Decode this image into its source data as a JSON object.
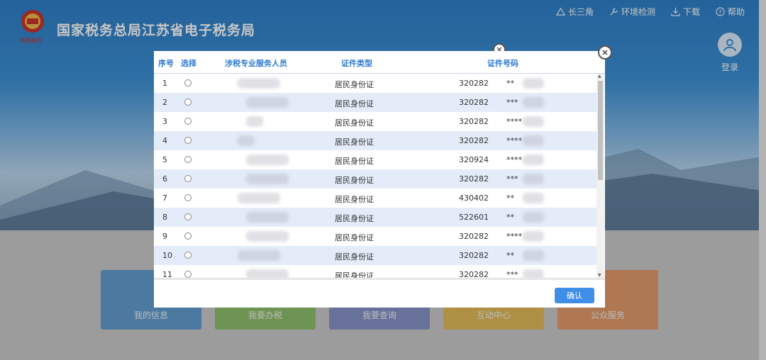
{
  "header": {
    "site_title": "国家税务总局江苏省电子税务局",
    "emblem_text": "中国税务",
    "nav": [
      {
        "icon": "triangle-icon",
        "label": "长三角"
      },
      {
        "icon": "wrench-icon",
        "label": "环境检测"
      },
      {
        "icon": "download-icon",
        "label": "下载"
      },
      {
        "icon": "help-icon",
        "label": "帮助"
      }
    ],
    "login_label": "登录"
  },
  "tiles": [
    {
      "label": "我的信息",
      "color": "#3e8ed1"
    },
    {
      "label": "我要办税",
      "color": "#7bba4a"
    },
    {
      "label": "我要查询",
      "color": "#6f7fc6"
    },
    {
      "label": "互动中心",
      "color": "#e7b534"
    },
    {
      "label": "公众服务",
      "color": "#e88b4d"
    }
  ],
  "modal": {
    "columns": [
      "序号",
      "选择",
      "涉税专业服务人员",
      "证件类型",
      "证件号码"
    ],
    "rows": [
      {
        "no": "1",
        "id_type": "居民身份证",
        "id_prefix": "320282",
        "id_mask": "**"
      },
      {
        "no": "2",
        "id_type": "居民身份证",
        "id_prefix": "320282",
        "id_mask": "***"
      },
      {
        "no": "3",
        "id_type": "居民身份证",
        "id_prefix": "320282",
        "id_mask": "****"
      },
      {
        "no": "4",
        "id_type": "居民身份证",
        "id_prefix": "320282",
        "id_mask": "****"
      },
      {
        "no": "5",
        "id_type": "居民身份证",
        "id_prefix": "320924",
        "id_mask": "****"
      },
      {
        "no": "6",
        "id_type": "居民身份证",
        "id_prefix": "320282",
        "id_mask": "***"
      },
      {
        "no": "7",
        "id_type": "居民身份证",
        "id_prefix": "430402",
        "id_mask": "**"
      },
      {
        "no": "8",
        "id_type": "居民身份证",
        "id_prefix": "522601",
        "id_mask": "**"
      },
      {
        "no": "9",
        "id_type": "居民身份证",
        "id_prefix": "320282",
        "id_mask": "****"
      },
      {
        "no": "10",
        "id_type": "居民身份证",
        "id_prefix": "320282",
        "id_mask": "**"
      },
      {
        "no": "11",
        "id_type": "居民身份证",
        "id_prefix": "320282",
        "id_mask": "***"
      }
    ],
    "confirm_label": "确认",
    "accent_color": "#2f7bd1",
    "row_alt_color": "#e3ecf8"
  }
}
